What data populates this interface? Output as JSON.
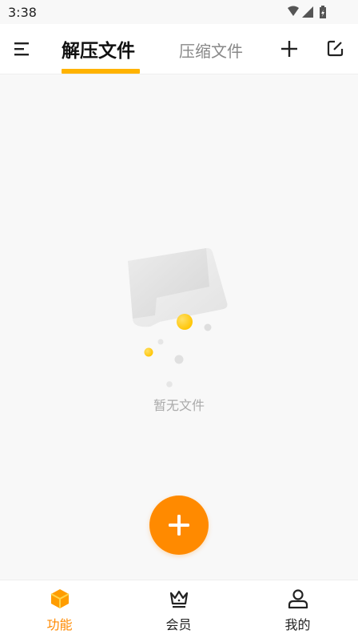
{
  "status_bar": {
    "time": "3:38"
  },
  "header": {
    "tabs": [
      {
        "label": "解压文件",
        "active": true
      },
      {
        "label": "压缩文件",
        "active": false
      }
    ]
  },
  "empty_state": {
    "message": "暂无文件"
  },
  "bottom_nav": {
    "items": [
      {
        "label": "功能",
        "icon": "cube-icon",
        "active": true
      },
      {
        "label": "会员",
        "icon": "crown-icon",
        "active": false
      },
      {
        "label": "我的",
        "icon": "person-icon",
        "active": false
      }
    ]
  },
  "colors": {
    "accent": "#ff8a00",
    "tab_underline": "#ffb300"
  }
}
